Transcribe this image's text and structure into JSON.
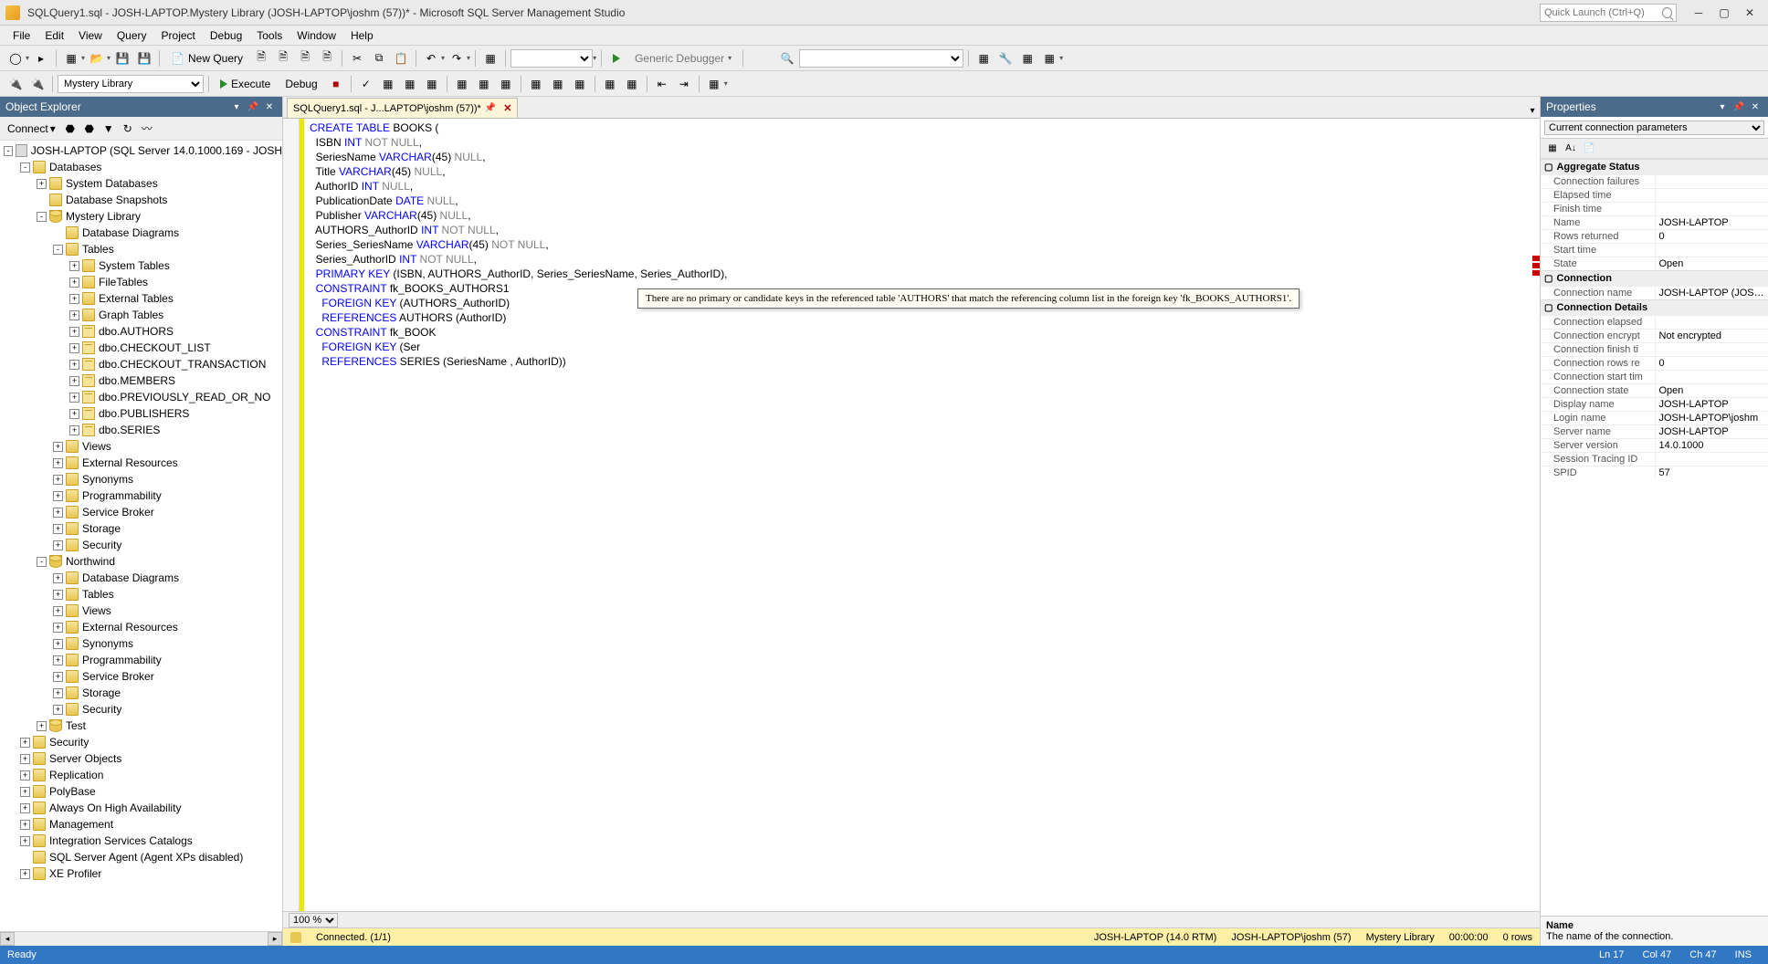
{
  "title": "SQLQuery1.sql - JOSH-LAPTOP.Mystery Library  (JOSH-LAPTOP\\joshm (57))* - Microsoft SQL Server Management Studio",
  "quick_launch_placeholder": "Quick Launch (Ctrl+Q)",
  "menu": [
    "File",
    "Edit",
    "View",
    "Query",
    "Project",
    "Debug",
    "Tools",
    "Window",
    "Help"
  ],
  "toolbar1": {
    "new_query": "New Query",
    "generic_debugger": "Generic Debugger"
  },
  "toolbar2": {
    "db_combo": "Mystery Library",
    "execute": "Execute",
    "debug": "Debug"
  },
  "object_explorer": {
    "title": "Object Explorer",
    "connect": "Connect",
    "root": "JOSH-LAPTOP (SQL Server 14.0.1000.169 - JOSH",
    "nodes": {
      "databases": "Databases",
      "system_databases": "System Databases",
      "database_snapshots": "Database Snapshots",
      "mystery_library": "Mystery Library",
      "database_diagrams": "Database Diagrams",
      "tables": "Tables",
      "system_tables": "System Tables",
      "filetables": "FileTables",
      "external_tables": "External Tables",
      "graph_tables": "Graph Tables",
      "dbo_authors": "dbo.AUTHORS",
      "dbo_checkout_list": "dbo.CHECKOUT_LIST",
      "dbo_checkout_transaction": "dbo.CHECKOUT_TRANSACTION",
      "dbo_members": "dbo.MEMBERS",
      "dbo_previously_read": "dbo.PREVIOUSLY_READ_OR_NO",
      "dbo_publishers": "dbo.PUBLISHERS",
      "dbo_series": "dbo.SERIES",
      "views": "Views",
      "external_resources": "External Resources",
      "synonyms": "Synonyms",
      "programmability": "Programmability",
      "service_broker": "Service Broker",
      "storage": "Storage",
      "security": "Security",
      "northwind": "Northwind",
      "test": "Test",
      "security2": "Security",
      "server_objects": "Server Objects",
      "replication": "Replication",
      "polybase": "PolyBase",
      "always_on": "Always On High Availability",
      "management": "Management",
      "integration_services": "Integration Services Catalogs",
      "sql_agent": "SQL Server Agent (Agent XPs disabled)",
      "xe_profiler": "XE Profiler"
    }
  },
  "tab": {
    "label": "SQLQuery1.sql - J...LAPTOP\\joshm (57))*"
  },
  "code_lines": [
    [
      [
        "kw",
        "CREATE"
      ],
      [
        "sp",
        " "
      ],
      [
        "kw",
        "TABLE"
      ],
      [
        "sp",
        " "
      ],
      [
        "id",
        "BOOKS"
      ],
      [
        "sp",
        " "
      ],
      [
        "id",
        "("
      ]
    ],
    [
      [
        "sp",
        "  "
      ],
      [
        "id",
        "ISBN "
      ],
      [
        "ty",
        "INT"
      ],
      [
        "sp",
        " "
      ],
      [
        "nn",
        "NOT NULL"
      ],
      [
        "id",
        ","
      ]
    ],
    [
      [
        "sp",
        "  "
      ],
      [
        "id",
        "SeriesName "
      ],
      [
        "ty",
        "VARCHAR"
      ],
      [
        "id",
        "("
      ],
      [
        "id",
        "45"
      ],
      [
        "id",
        ") "
      ],
      [
        "nn",
        "NULL"
      ],
      [
        "id",
        ","
      ]
    ],
    [
      [
        "sp",
        "  "
      ],
      [
        "id",
        "Title "
      ],
      [
        "ty",
        "VARCHAR"
      ],
      [
        "id",
        "("
      ],
      [
        "id",
        "45"
      ],
      [
        "id",
        ") "
      ],
      [
        "nn",
        "NULL"
      ],
      [
        "id",
        ","
      ]
    ],
    [
      [
        "sp",
        "  "
      ],
      [
        "id",
        "AuthorID "
      ],
      [
        "ty",
        "INT"
      ],
      [
        "sp",
        " "
      ],
      [
        "nn",
        "NULL"
      ],
      [
        "id",
        ","
      ]
    ],
    [
      [
        "sp",
        "  "
      ],
      [
        "id",
        "PublicationDate "
      ],
      [
        "ty",
        "DATE"
      ],
      [
        "sp",
        " "
      ],
      [
        "nn",
        "NULL"
      ],
      [
        "id",
        ","
      ]
    ],
    [
      [
        "sp",
        "  "
      ],
      [
        "id",
        "Publisher "
      ],
      [
        "ty",
        "VARCHAR"
      ],
      [
        "id",
        "("
      ],
      [
        "id",
        "45"
      ],
      [
        "id",
        ") "
      ],
      [
        "nn",
        "NULL"
      ],
      [
        "id",
        ","
      ]
    ],
    [
      [
        "sp",
        "  "
      ],
      [
        "id",
        "AUTHORS_AuthorID "
      ],
      [
        "ty",
        "INT"
      ],
      [
        "sp",
        " "
      ],
      [
        "nn",
        "NOT NULL"
      ],
      [
        "id",
        ","
      ]
    ],
    [
      [
        "sp",
        "  "
      ],
      [
        "id",
        "Series_SeriesName "
      ],
      [
        "ty",
        "VARCHAR"
      ],
      [
        "id",
        "("
      ],
      [
        "id",
        "45"
      ],
      [
        "id",
        ") "
      ],
      [
        "nn",
        "NOT NULL"
      ],
      [
        "id",
        ","
      ]
    ],
    [
      [
        "sp",
        "  "
      ],
      [
        "id",
        "Series_AuthorID "
      ],
      [
        "ty",
        "INT"
      ],
      [
        "sp",
        " "
      ],
      [
        "nn",
        "NOT NULL"
      ],
      [
        "id",
        ","
      ]
    ],
    [
      [
        "sp",
        "  "
      ],
      [
        "kw",
        "PRIMARY KEY"
      ],
      [
        "sp",
        " "
      ],
      [
        "id",
        "(ISBN, AUTHORS_AuthorID, Series_SeriesName, Series_AuthorID),"
      ]
    ],
    [
      [
        "sp",
        "  "
      ],
      [
        "kw",
        "CONSTRAINT"
      ],
      [
        "sp",
        " "
      ],
      [
        "id",
        "fk_BOOKS_AUTHORS1"
      ]
    ],
    [
      [
        "sp",
        "    "
      ],
      [
        "kw",
        "FOREIGN KEY"
      ],
      [
        "sp",
        " "
      ],
      [
        "id",
        "(AUTHORS_AuthorID)"
      ]
    ],
    [
      [
        "sp",
        "    "
      ],
      [
        "kw",
        "REFERENCES"
      ],
      [
        "sp",
        " "
      ],
      [
        "id",
        "AUTHORS (AuthorID)"
      ]
    ],
    [
      [
        "sp",
        "  "
      ],
      [
        "kw",
        "CONSTRAINT"
      ],
      [
        "sp",
        " "
      ],
      [
        "id",
        "fk_BOOK"
      ]
    ],
    [
      [
        "sp",
        "    "
      ],
      [
        "kw",
        "FOREIGN KEY"
      ],
      [
        "sp",
        " "
      ],
      [
        "id",
        "(Ser"
      ]
    ],
    [
      [
        "sp",
        "    "
      ],
      [
        "kw",
        "REFERENCES"
      ],
      [
        "sp",
        " "
      ],
      [
        "id",
        "SERIES (SeriesName , AuthorID))"
      ]
    ]
  ],
  "tooltip": "There are no primary or candidate keys in the referenced table 'AUTHORS' that match the referencing column list in the foreign key 'fk_BOOKS_AUTHORS1'.",
  "zoom": "100 %",
  "editor_status": {
    "connected": "Connected. (1/1)",
    "server": "JOSH-LAPTOP (14.0 RTM)",
    "user": "JOSH-LAPTOP\\joshm (57)",
    "db": "Mystery Library",
    "elapsed": "00:00:00",
    "rows": "0 rows"
  },
  "properties": {
    "title": "Properties",
    "combo": "Current connection parameters",
    "categories": {
      "aggregate": "Aggregate Status",
      "connection": "Connection",
      "connection_details": "Connection Details"
    },
    "rows": [
      {
        "k": "Connection failures",
        "v": ""
      },
      {
        "k": "Elapsed time",
        "v": ""
      },
      {
        "k": "Finish time",
        "v": ""
      },
      {
        "k": "Name",
        "v": "JOSH-LAPTOP"
      },
      {
        "k": "Rows returned",
        "v": "0"
      },
      {
        "k": "Start time",
        "v": ""
      },
      {
        "k": "State",
        "v": "Open"
      }
    ],
    "rows2": [
      {
        "k": "Connection name",
        "v": "JOSH-LAPTOP (JOSH-L"
      }
    ],
    "rows3": [
      {
        "k": "Connection elapsed",
        "v": ""
      },
      {
        "k": "Connection encrypt",
        "v": "Not encrypted"
      },
      {
        "k": "Connection finish ti",
        "v": ""
      },
      {
        "k": "Connection rows re",
        "v": "0"
      },
      {
        "k": "Connection start tim",
        "v": ""
      },
      {
        "k": "Connection state",
        "v": "Open"
      },
      {
        "k": "Display name",
        "v": "JOSH-LAPTOP"
      },
      {
        "k": "Login name",
        "v": "JOSH-LAPTOP\\joshm"
      },
      {
        "k": "Server name",
        "v": "JOSH-LAPTOP"
      },
      {
        "k": "Server version",
        "v": "14.0.1000"
      },
      {
        "k": "Session Tracing ID",
        "v": ""
      },
      {
        "k": "SPID",
        "v": "57"
      }
    ],
    "desc_title": "Name",
    "desc_body": "The name of the connection."
  },
  "statusbar": {
    "ready": "Ready",
    "ln": "Ln 17",
    "col": "Col 47",
    "ch": "Ch 47",
    "ins": "INS"
  }
}
